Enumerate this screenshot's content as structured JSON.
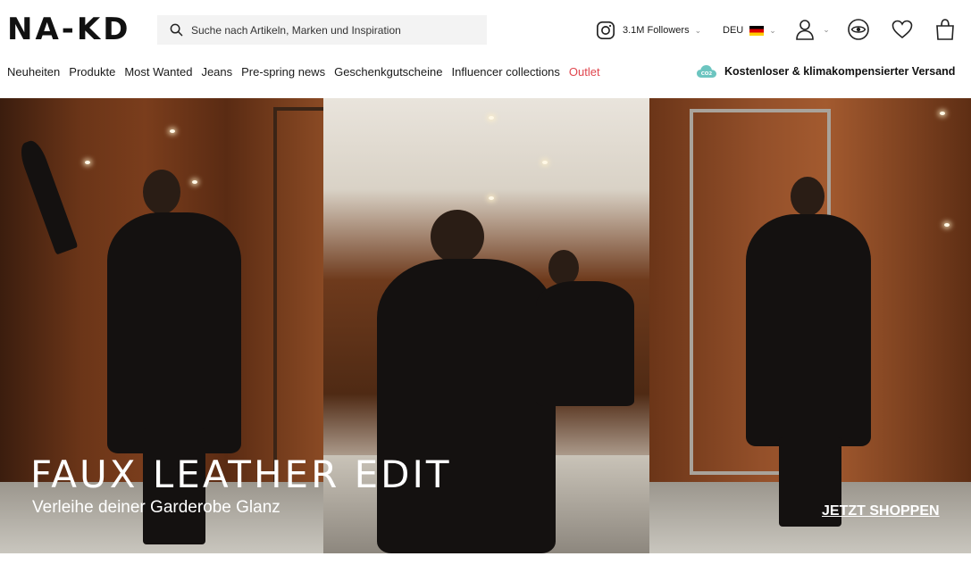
{
  "brand": {
    "logo_text": "NA-KD"
  },
  "search": {
    "placeholder": "Suche nach Artikeln, Marken und Inspiration"
  },
  "social": {
    "label": "3.1M Followers",
    "icon": "instagram-icon"
  },
  "region": {
    "code": "DEU",
    "flag": "germany-flag"
  },
  "header_icons": [
    "account-icon",
    "eye-icon",
    "heart-icon",
    "bag-icon"
  ],
  "nav": {
    "items": [
      {
        "label": "Neuheiten"
      },
      {
        "label": "Produkte"
      },
      {
        "label": "Most Wanted"
      },
      {
        "label": "Jeans"
      },
      {
        "label": "Pre-spring news"
      },
      {
        "label": "Geschenkgutscheine"
      },
      {
        "label": "Influencer collections"
      },
      {
        "label": "Outlet"
      }
    ]
  },
  "shipping": {
    "badge": "CO2",
    "label": "Kostenloser & klimakompensierter Versand"
  },
  "hero": {
    "title": "FAUX LEATHER EDIT",
    "subtitle": "Verleihe deiner Garderobe Glanz",
    "cta": "JETZT SHOPPEN"
  },
  "colors": {
    "outlet": "#e0464e",
    "shipping_badge": "#6cc5c0",
    "search_bg": "#f3f3f3"
  }
}
